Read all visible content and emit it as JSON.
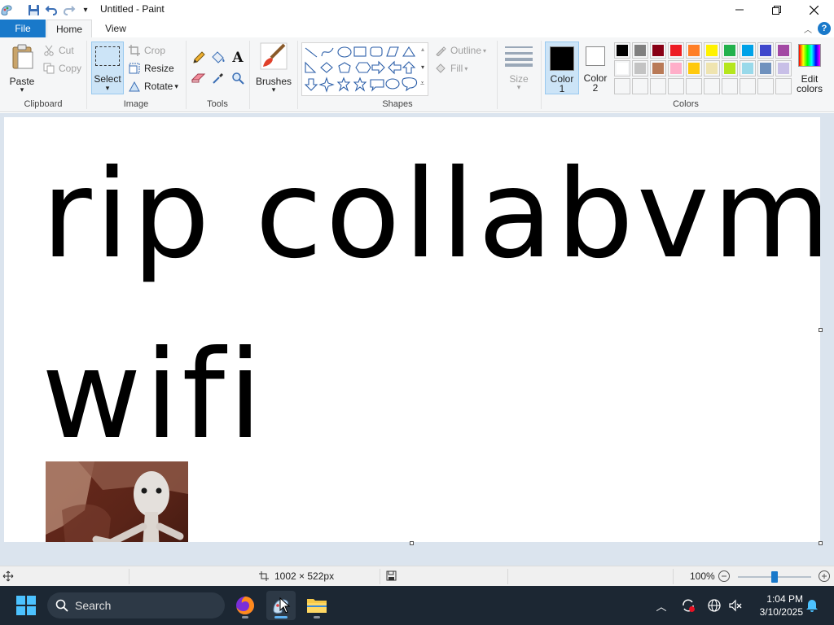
{
  "window": {
    "title": "Untitled - Paint",
    "minimize": "—",
    "restore": "❐",
    "close": "✕"
  },
  "tabs": {
    "file": "File",
    "home": "Home",
    "view": "View"
  },
  "ribbon": {
    "clipboard": {
      "label": "Clipboard",
      "paste": "Paste",
      "cut": "Cut",
      "copy": "Copy"
    },
    "image": {
      "label": "Image",
      "select": "Select",
      "crop": "Crop",
      "resize": "Resize",
      "rotate": "Rotate"
    },
    "tools": {
      "label": "Tools"
    },
    "brushes": {
      "label": "Brushes"
    },
    "shapes": {
      "label": "Shapes",
      "outline": "Outline",
      "fill": "Fill"
    },
    "size": {
      "label": "Size"
    },
    "color1": {
      "label": "Color",
      "sub": "1",
      "value": "#000000"
    },
    "color2": {
      "label": "Color",
      "sub": "2",
      "value": "#ffffff"
    },
    "colors": {
      "label": "Colors",
      "edit_label": "Edit",
      "edit_sub": "colors",
      "row1": [
        "#000000",
        "#7f7f7f",
        "#880015",
        "#ed1c24",
        "#ff7f27",
        "#fff200",
        "#22b14c",
        "#00a2e8",
        "#3f48cc",
        "#a349a4"
      ],
      "row2": [
        "#ffffff",
        "#c3c3c3",
        "#b97a57",
        "#ffaec9",
        "#ffc90e",
        "#efe4b0",
        "#b5e61d",
        "#99d9ea",
        "#7092be",
        "#c8bfe7"
      ]
    }
  },
  "canvas": {
    "line1": "rip collabvm",
    "line2": "wifi"
  },
  "status": {
    "canvas_size": "1002 × 522px",
    "zoom": "100%",
    "zoom_level": 0.5
  },
  "taskbar": {
    "search": "Search",
    "time": "1:04 PM",
    "date": "3/10/2025"
  }
}
